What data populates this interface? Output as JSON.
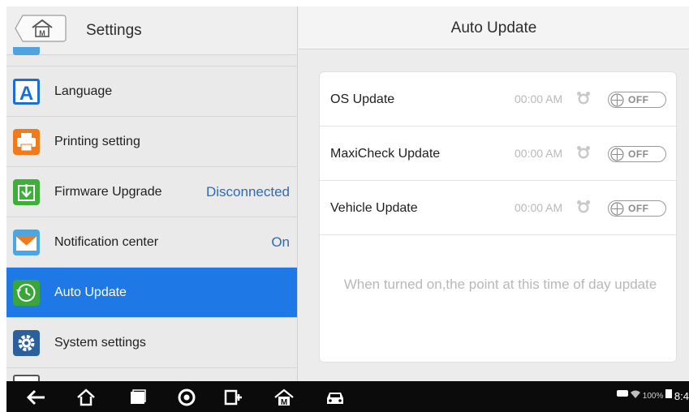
{
  "left_panel": {
    "title": "Settings",
    "items": [
      {
        "label": "Language",
        "value": "",
        "icon": "language-icon"
      },
      {
        "label": "Printing setting",
        "value": "",
        "icon": "printer-icon"
      },
      {
        "label": "Firmware Upgrade",
        "value": "Disconnected",
        "icon": "firmware-upgrade-icon"
      },
      {
        "label": "Notification center",
        "value": "On",
        "icon": "notification-icon"
      },
      {
        "label": "Auto Update",
        "value": "",
        "icon": "auto-update-icon",
        "active": true
      },
      {
        "label": "System settings",
        "value": "",
        "icon": "gear-icon"
      }
    ]
  },
  "right_panel": {
    "title": "Auto Update",
    "rows": [
      {
        "label": "OS Update",
        "time": "00:00 AM",
        "toggle": "OFF"
      },
      {
        "label": "MaxiCheck Update",
        "time": "00:00 AM",
        "toggle": "OFF"
      },
      {
        "label": "Vehicle Update",
        "time": "00:00 AM",
        "toggle": "OFF"
      }
    ],
    "note": "When turned on,the point at this time of day update"
  },
  "navbar": {
    "icons": [
      "back-icon",
      "home-icon",
      "recent-apps-icon",
      "chrome-icon",
      "vci-connect-icon",
      "maxi-home-icon",
      "car-icon"
    ],
    "status": {
      "battery": "100%",
      "time": "8:4"
    }
  },
  "colors": {
    "active": "#1e78e6",
    "value_text": "#2d6bb3",
    "navbar": "#0b0b0b"
  }
}
